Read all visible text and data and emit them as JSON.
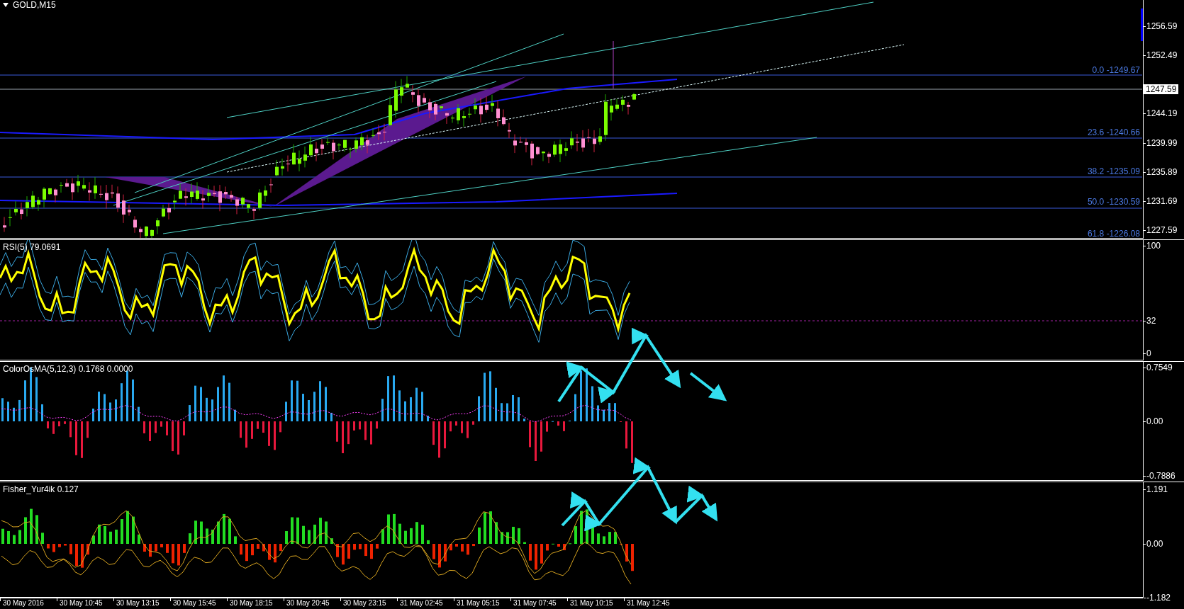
{
  "chart": {
    "title": "GOLD,M15",
    "price_axis": [
      "1256.59",
      "1252.49",
      "1244.19",
      "1239.99",
      "1235.89",
      "1231.69",
      "1227.59"
    ],
    "current_price": "1247.59",
    "fibonacci_levels": [
      "0.0 -1249.67",
      "23.6 -1240.66",
      "38.2 -1235.09",
      "50.0 -1230.59",
      "61.8 -1226.08"
    ]
  },
  "indicators": [
    {
      "title": "RSI(5) 79.0691",
      "axis": [
        "100",
        "32",
        "0"
      ]
    },
    {
      "title": "ColorOsMA(5,12,3) 0.1768 0.0000",
      "axis": [
        "0.7549",
        "0.00",
        "-0.7886"
      ]
    },
    {
      "title": "Fisher_Yur4ik 0.127",
      "axis": [
        "1.191",
        "0.00",
        "-1.182"
      ]
    }
  ],
  "time_axis": [
    "30 May 2016",
    "30 May 10:45",
    "30 May 13:15",
    "30 May 15:45",
    "30 May 18:15",
    "30 May 20:45",
    "30 May 23:15",
    "31 May 02:45",
    "31 May 05:15",
    "31 May 07:45",
    "31 May 10:15",
    "31 May 12:45"
  ]
}
